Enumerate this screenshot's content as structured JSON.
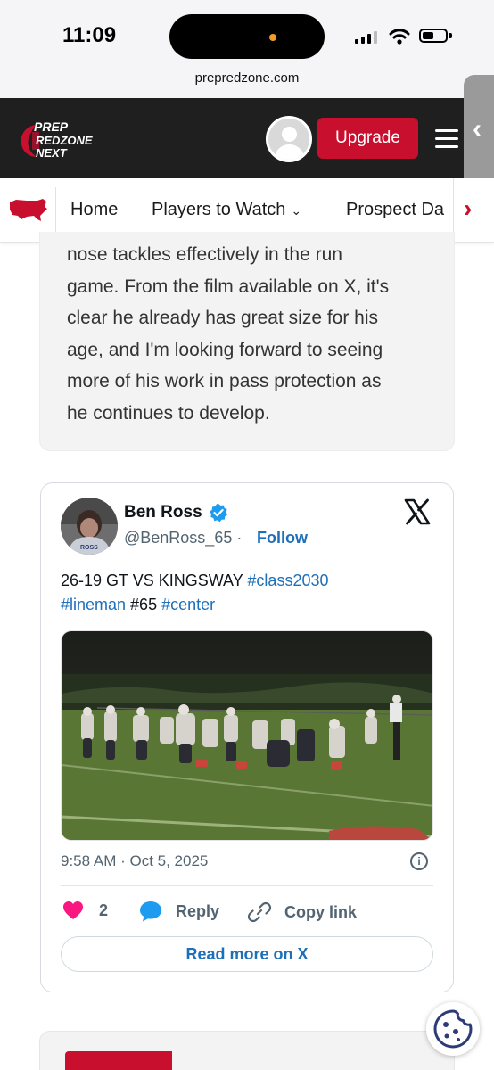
{
  "status_bar": {
    "time": "11:09"
  },
  "browser": {
    "url": "prepredzone.com"
  },
  "header": {
    "logo_lines": [
      "PREP",
      "REDZONE",
      "NEXT"
    ],
    "upgrade_label": "Upgrade",
    "accent_color": "#c8102e",
    "background_color": "#1f1f1f"
  },
  "nav": {
    "items": [
      {
        "label": "Home"
      },
      {
        "label": "Players to Watch",
        "has_dropdown": true
      },
      {
        "label": "Prospect Da"
      }
    ]
  },
  "article": {
    "lines": [
      "nose tackles effectively in the run",
      "game. From the film available on X, it's",
      "clear he already has great size for his",
      "age, and I'm looking forward to seeing",
      "more of his work in pass protection as",
      "he continues to develop."
    ]
  },
  "tweet": {
    "author_name": "Ben Ross",
    "handle": "@BenRoss_65",
    "separator": "·",
    "follow_label": "Follow",
    "text_plain_1": "26-19 GT VS KINGSWAY ",
    "hashtag_1": "#class2030",
    "hashtag_2": "#lineman",
    "text_plain_2": " #65 ",
    "hashtag_3": "#center",
    "timestamp": "9:58 AM · Oct 5, 2025",
    "likes": "2",
    "reply_label": "Reply",
    "copy_link_label": "Copy link",
    "read_more_label": "Read more on X",
    "avatar_jersey_text": "ROSS"
  }
}
